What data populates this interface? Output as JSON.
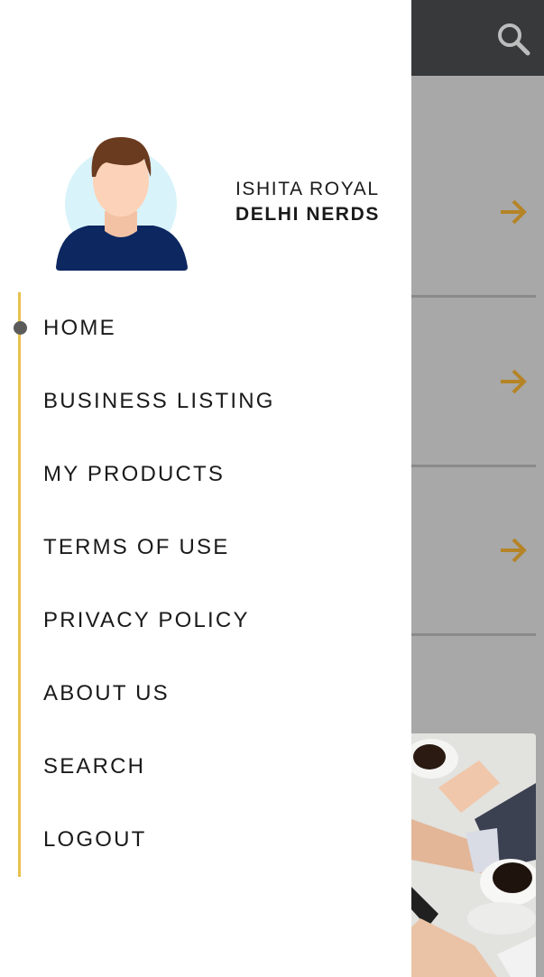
{
  "user": {
    "name": "ISHITA ROYAL",
    "organization": "DELHI NERDS"
  },
  "menu": {
    "items": [
      {
        "label": "HOME",
        "active": true
      },
      {
        "label": "BUSINESS LISTING",
        "active": false
      },
      {
        "label": "MY PRODUCTS",
        "active": false
      },
      {
        "label": "TERMS OF USE",
        "active": false
      },
      {
        "label": "PRIVACY POLICY",
        "active": false
      },
      {
        "label": "ABOUT US",
        "active": false
      },
      {
        "label": "SEARCH",
        "active": false
      },
      {
        "label": "LOGOUT",
        "active": false
      }
    ]
  },
  "icons": {
    "topbar_search": "search-icon",
    "row_arrow": "arrow-right-icon",
    "avatar": "user-avatar-icon"
  },
  "colors": {
    "accent_line": "#e8c04c",
    "arrow": "#b58426",
    "topbar": "#38393b",
    "active_dot": "#5b5b5b"
  }
}
